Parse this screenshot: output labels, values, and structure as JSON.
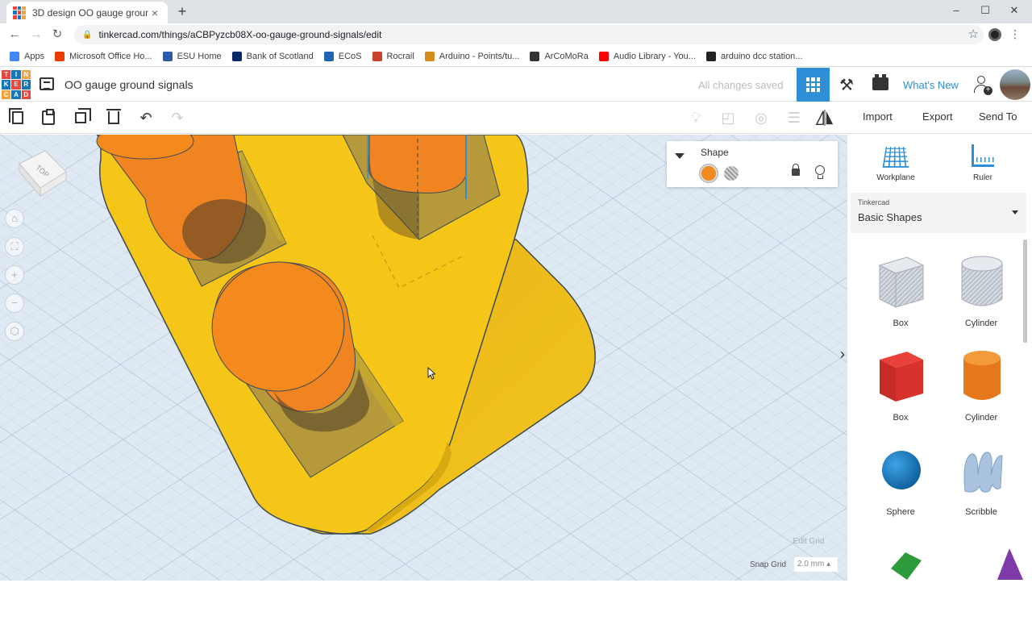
{
  "browser": {
    "tab_title": "3D design OO gauge ground sig",
    "tab_close": "×",
    "new_tab": "+",
    "url": "tinkercad.com/things/aCBPyzcb08X-oo-gauge-ground-signals/edit",
    "win_min": "–",
    "win_max": "☐",
    "win_close": "✕"
  },
  "bookmarks": [
    {
      "label": "Apps",
      "color": "#4285f4"
    },
    {
      "label": "Microsoft Office Ho...",
      "color": "#eb3c00"
    },
    {
      "label": "ESU Home",
      "color": "#2d5aa8"
    },
    {
      "label": "Bank of Scotland",
      "color": "#0a2a66"
    },
    {
      "label": "ECoS",
      "color": "#1f64b5"
    },
    {
      "label": "Rocrail",
      "color": "#c9432c"
    },
    {
      "label": "Arduino - Points/tu...",
      "color": "#d98c1e"
    },
    {
      "label": "ArCoMoRa",
      "color": "#333333"
    },
    {
      "label": "Audio Library - You...",
      "color": "#ff0000"
    },
    {
      "label": "arduino dcc station...",
      "color": "#222222"
    }
  ],
  "header": {
    "logo_letters": [
      "TIN",
      "KER",
      "CAD"
    ],
    "title": "OO gauge ground signals",
    "save_status": "All changes saved",
    "whats_new": "What's New",
    "accent": "#2e8fd6"
  },
  "toolbar": {
    "import": "Import",
    "export": "Export",
    "send_to": "Send To"
  },
  "viewcube_label": "TOP",
  "inspector": {
    "title": "Shape",
    "solid_color": "#f18b1f"
  },
  "workspace": {
    "edit_grid": "Edit Grid",
    "snap_grid_label": "Snap Grid",
    "snap_grid_value": "2.0 mm ▴"
  },
  "right_panel": {
    "workplane": "Workplane",
    "ruler": "Ruler",
    "library_source": "Tinkercad",
    "library_name": "Basic Shapes",
    "shapes": [
      {
        "label": "Box",
        "kind": "box-hole"
      },
      {
        "label": "Cylinder",
        "kind": "cylinder-hole"
      },
      {
        "label": "Box",
        "kind": "box-red"
      },
      {
        "label": "Cylinder",
        "kind": "cylinder-orange"
      },
      {
        "label": "Sphere",
        "kind": "sphere-blue"
      },
      {
        "label": "Scribble",
        "kind": "scribble"
      }
    ]
  },
  "colors": {
    "body_yellow": "#f5c518",
    "peg_orange": "#ef8420",
    "grid_background": "#dfe9f3"
  }
}
